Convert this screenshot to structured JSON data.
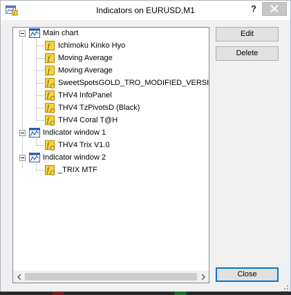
{
  "window": {
    "title": "Indicators on EURUSD,M1",
    "help_label": "?"
  },
  "tree": {
    "nodes": [
      {
        "label": "Main chart",
        "type": "window-icon"
      },
      {
        "label": "Ichimoku Kinko Hyo",
        "type": "function-icon"
      },
      {
        "label": "Moving Average",
        "type": "function-icon"
      },
      {
        "label": "Moving Average",
        "type": "function-icon"
      },
      {
        "label": "SweetSpotsGOLD_TRO_MODIFIED_VERSION",
        "type": "custom-function-icon"
      },
      {
        "label": "THV4 InfoPanel",
        "type": "custom-function-icon"
      },
      {
        "label": "THV4 TzPivotsD (Black)",
        "type": "custom-function-icon"
      },
      {
        "label": "THV4 Coral  T@H",
        "type": "custom-function-icon"
      },
      {
        "label": "Indicator window 1",
        "type": "window-icon"
      },
      {
        "label": "THV4 Trix V1.0",
        "type": "custom-function-icon"
      },
      {
        "label": "Indicator window 2",
        "type": "window-icon"
      },
      {
        "label": "_TRIX MTF",
        "type": "custom-function-icon"
      }
    ]
  },
  "buttons": {
    "edit": "Edit",
    "delete": "Delete",
    "close": "Close"
  },
  "colors": {
    "accent": "#0078d7",
    "icon_yellow": "#f5d442",
    "icon_blue": "#2a5db0"
  }
}
